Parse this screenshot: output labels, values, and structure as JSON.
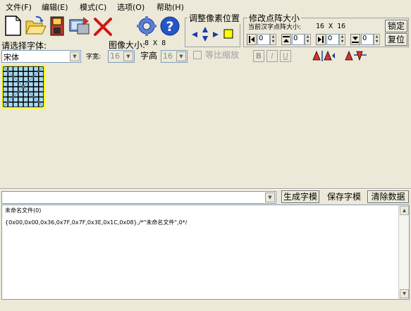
{
  "menu": {
    "items": [
      {
        "label": "文件(F)"
      },
      {
        "label": "编辑(E)"
      },
      {
        "label": "模式(C)"
      },
      {
        "label": "选项(O)"
      },
      {
        "label": "帮助(H)"
      }
    ]
  },
  "toolbar": {
    "icons": [
      "new-file-icon",
      "open-folder-icon",
      "save-disk-icon",
      "export-icon",
      "delete-x-icon",
      "settings-gear-icon",
      "help-icon"
    ]
  },
  "pixel_adjust": {
    "title": "调整像素位置"
  },
  "resize": {
    "title": "修改点阵大小",
    "current_label": "当前汉字点阵大小:",
    "current_value": "16 X 16",
    "lock_label": "锁定",
    "reset_label": "复位",
    "spin_values": [
      "0",
      "0",
      "0",
      "0"
    ]
  },
  "font": {
    "select_label": "请选择字体:",
    "font_name": "宋体",
    "image_size_label": "图像大小:",
    "image_size_value": "8 X 8",
    "char_width_label": "字宽:",
    "char_width_value": "16",
    "char_height_label": "字高",
    "char_height_value": "16",
    "proportional_label": "等比缩放",
    "bold_label": "B",
    "italic_label": "I",
    "underline_label": "U"
  },
  "actions": {
    "generate_label": "生成字模",
    "save_label": "保存字模",
    "clear_label": "清除数据"
  },
  "output": {
    "lines": [
      "未命名文件(0)",
      "{0x00,0x00,0x36,0x7F,0x7F,0x3E,0x1C,0x08},/*\"未命名文件\",0*/"
    ]
  },
  "colors": {
    "grid_fill": "#a8d8f0",
    "grid_line": "#000000",
    "grid_border": "#ffff00",
    "background": "#ece9d8"
  }
}
